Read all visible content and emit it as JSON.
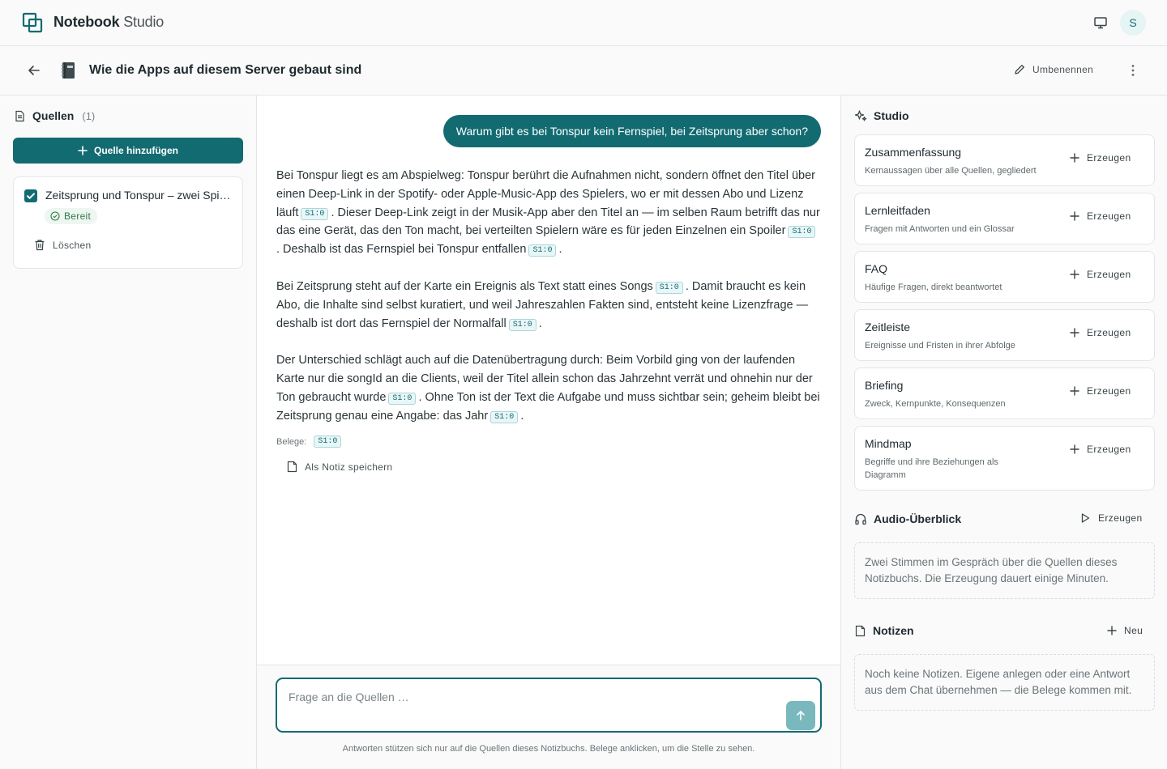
{
  "app": {
    "brand_bold": "Notebook",
    "brand_light": "Studio",
    "avatar_initial": "S"
  },
  "titlebar": {
    "title": "Wie die Apps auf diesem Server gebaut sind",
    "rename_label": "Umbenennen"
  },
  "sources": {
    "title": "Quellen",
    "count": "(1)",
    "add_label": "Quelle hinzufügen",
    "items": [
      {
        "name": "Zeitsprung und Tonspur – zwei Spielvarianten",
        "status": "Bereit",
        "delete_label": "Löschen"
      }
    ]
  },
  "chat": {
    "user_message": "Warum gibt es bei Tonspur kein Fernspiel, bei Zeitsprung aber schon?",
    "answer": {
      "p1": [
        "Bei Tonspur liegt es am Abspielweg: Tonspur berührt die Aufnahmen nicht, sondern öffnet den Titel über einen Deep-Link in der Spotify- oder Apple-Music-App des Spielers, wo er mit dessen Abo und Lizenz läuft",
        ". Dieser Deep-Link zeigt in der Musik-App aber den Titel an — im selben Raum betrifft das nur das eine Gerät, das den Ton macht, bei verteilten Spielern wäre es für jeden Einzelnen ein Spoiler",
        ". Deshalb ist das Fernspiel bei Tonspur entfallen",
        "."
      ],
      "p2": [
        "Bei Zeitsprung steht auf der Karte ein Ereignis als Text statt eines Songs",
        ". Damit braucht es kein Abo, die Inhalte sind selbst kuratiert, und weil Jahreszahlen Fakten sind, entsteht keine Lizenzfrage — deshalb ist dort das Fernspiel der Normalfall",
        "."
      ],
      "p3": [
        "Der Unterschied schlägt auch auf die Datenübertragung durch: Beim Vorbild ging von der laufenden Karte nur die songId an die Clients, weil der Titel allein schon das Jahrzehnt verrät und ohnehin nur der Ton gebraucht wurde",
        ". Ohne Ton ist der Text die Aufgabe und muss sichtbar sein; geheim bleibt bei Zeitsprung genau eine Angabe: das Jahr",
        "."
      ],
      "citation": "S1:0"
    },
    "evidence_label": "Belege:",
    "save_note_label": "Als Notiz speichern",
    "input_placeholder": "Frage an die Quellen …",
    "disclaimer": "Antworten stützen sich nur auf die Quellen dieses Notizbuchs. Belege anklicken, um die Stelle zu sehen."
  },
  "studio": {
    "title": "Studio",
    "generate_label": "Erzeugen",
    "cards": [
      {
        "title": "Zusammenfassung",
        "desc": "Kernaussagen über alle Quellen, gegliedert"
      },
      {
        "title": "Lernleitfaden",
        "desc": "Fragen mit Antworten und ein Glossar"
      },
      {
        "title": "FAQ",
        "desc": "Häufige Fragen, direkt beantwortet"
      },
      {
        "title": "Zeitleiste",
        "desc": "Ereignisse und Fristen in ihrer Abfolge"
      },
      {
        "title": "Briefing",
        "desc": "Zweck, Kernpunkte, Konsequenzen"
      },
      {
        "title": "Mindmap",
        "desc": "Begriffe und ihre Beziehungen als Diagramm"
      }
    ],
    "audio": {
      "title": "Audio-Überblick",
      "generate_label": "Erzeugen",
      "description": "Zwei Stimmen im Gespräch über die Quellen dieses Notizbuchs. Die Erzeugung dauert einige Minuten."
    },
    "notes": {
      "title": "Notizen",
      "new_label": "Neu",
      "empty_text": "Noch keine Notizen. Eigene anlegen oder eine Antwort aus dem Chat übernehmen — die Belege kommen mit."
    }
  },
  "colors": {
    "accent": "#136b72",
    "accent_light": "#79b9bd",
    "ready_green": "#2f7a4a"
  }
}
